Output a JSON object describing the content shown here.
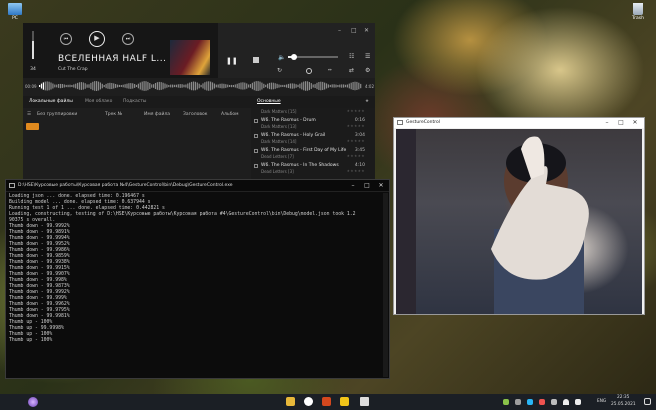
{
  "desktop": {
    "icons": [
      {
        "label": "PC"
      },
      {
        "label": "Trash"
      }
    ]
  },
  "player": {
    "volume": "34",
    "title": "ВСЕЛЕННАЯ HALF L...",
    "subtitle": "Cut The Crap",
    "time_elapsed": "00:09",
    "time_total": "4:02",
    "tabs": [
      "Локальные файлы",
      "Моя облако",
      "Подкасты"
    ],
    "active_panel_tab": "Основные",
    "group_label": "Без группировки",
    "columns": [
      "Трек №",
      "Имя файла",
      "Заголовок",
      "Альбом"
    ],
    "playlist": [
      {
        "title": "Dark Matters [15]",
        "sub": "",
        "duration": ""
      },
      {
        "title": "W6. The Rasmus - Drum",
        "sub": "Dark Matters [13]",
        "duration": "0:16"
      },
      {
        "title": "W6. The Rasmus - Holy Grail",
        "sub": "Dark Matters [14]",
        "duration": "3:04"
      },
      {
        "title": "W6. The Rasmus - First Day of My Life",
        "sub": "Dead Letters [7]",
        "duration": "3:45"
      },
      {
        "title": "W6. The Rasmus - In The Shadows",
        "sub": "Dead Letters [3]",
        "duration": "4:10"
      }
    ]
  },
  "console": {
    "title": "D:\\HSE\\Курсовые работы\\Курсовая работа №4\\GestureControl\\bin\\Debug\\GestureControl.exe",
    "lines": [
      "Loading json ... done. elapsed time: 0.196467 s",
      "Building model ... done. elapsed time: 0.637944 s",
      "Running test 1 of 1 ... done. elapsed time: 0.442821 s",
      "Loading, constructing, testing of D:\\HSE\\Курсовые работы\\Курсовая работа #4\\GestureControl\\bin\\Debug\\model.json took 1.2",
      "90375 s overall.",
      "Thumb down - 99.9992%",
      "Thumb down - 99.9891%",
      "Thumb down - 99.9994%",
      "Thumb down - 99.9952%",
      "Thumb down - 99.9986%",
      "Thumb down - 99.9859%",
      "Thumb down - 99.9938%",
      "Thumb down - 99.9915%",
      "Thumb down - 99.9907%",
      "Thumb down - 99.998%",
      "Thumb down - 99.9873%",
      "Thumb down - 99.9992%",
      "Thumb down - 99.999%",
      "Thumb down - 99.9962%",
      "Thumb down - 99.9795%",
      "Thumb down - 99.9981%",
      "Thumb up - 100%",
      "Thumb up - 99.9998%",
      "Thumb up - 100%",
      "Thumb up - 100%"
    ]
  },
  "camera": {
    "title": "GestureControl"
  },
  "taskbar": {
    "lang": "ENG",
    "time": "22:35",
    "date": "25.05.2021"
  },
  "colors": {
    "accent": "#e08a1e",
    "console_bg": "#0c0c0c",
    "player_bg": "#1e1e1e",
    "taskbar_bg": "#1b1f25"
  }
}
